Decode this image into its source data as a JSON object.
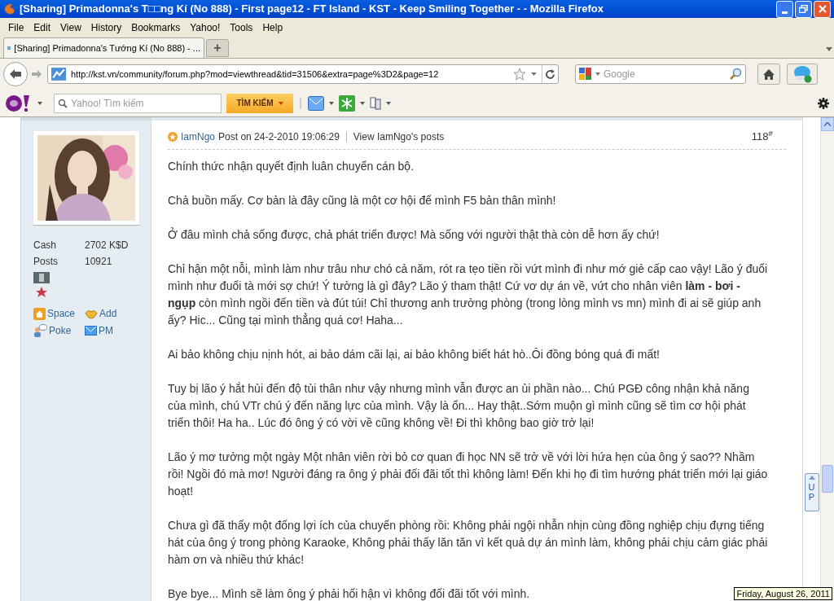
{
  "window": {
    "title": "[Sharing] Primadonna's T□□ng Kí (No 888) - First page12 - FT Island - KST - Keep Smiling Together - - Mozilla Firefox"
  },
  "menu": [
    "File",
    "Edit",
    "View",
    "History",
    "Bookmarks",
    "Yahoo!",
    "Tools",
    "Help"
  ],
  "tabs": [
    {
      "label": "[Sharing] Primadonna's Tướng Kí (No 888) - ...",
      "selected": true
    }
  ],
  "new_tab": "+",
  "address": {
    "value": "http://kst.vn/community/forum.php?mod=viewthread&tid=31506&extra=page%3D2&page=12"
  },
  "search": {
    "placeholder": "Google"
  },
  "yahoo_toolbar": {
    "search_placeholder": "Yahoo! Tìm kiếm",
    "search_button": "TÌM KIẾM"
  },
  "profile": {
    "stats": [
      {
        "label": "Cash",
        "value": "2702 K$D"
      },
      {
        "label": "Posts",
        "value": "10921"
      }
    ],
    "links": [
      {
        "kind": "space",
        "label": "Space"
      },
      {
        "kind": "add",
        "label": "Add"
      },
      {
        "kind": "poke",
        "label": "Poke"
      },
      {
        "kind": "pm",
        "label": "PM"
      }
    ]
  },
  "post": {
    "author": "IamNgo",
    "posted": "Post on 24-2-2010 19:06:29",
    "view_posts": "View IamNgo's posts",
    "floor": "118",
    "floor_mark": "#",
    "paragraphs": [
      "Chính thức nhận quyết định luân chuyển cán bộ.",
      "Chả  buồn mấy. Cơ bản là đây cũng là một cơ hội để mình F5 bản thân mình!",
      "Ở đâu mình chả sống được, chả phát triển được! Mà sống với người thật thà còn dễ hơn ấy chứ!",
      "Chỉ hận một nỗi, mình làm như trâu như chó cả năm, rót ra tẹo tiền rồi vứt mình đi như mớ giẻ cấp cao vậy! Lão ý đuổi mình như đuổi tà mới sợ chứ! Ý tưởng là gì đây? Lão ý tham thật! Cứ vơ dự án về, vứt cho nhân viên **làm - bơi - ngụp** còn mình ngồi đến tiền và đút túi! Chỉ thương anh trưởng phòng (trong lòng mình vs mn) mình đi ai sẽ giúp anh ấy? Hic... Cũng tại mình thẳng quá cơ! Haha...",
      "Ai bảo không chịu nịnh hót, ai bảo dám cãi lại, ai bảo không biết hát hò..Ôi đồng bóng quá đi mất!",
      "Tuy bị lão ý hắt hủi đến độ tủi thân như vậy nhưng mình vẫn được an ủi phần nào... Chú PGĐ công nhận khả năng của mình, chú VTr chú ý đến năng lực của mình. Vậy là ổn... Hay thật..Sớm muộn gì mình cũng sẽ tìm cơ hội phát triển thôi! Ha ha.. Lúc đó ông ý có vời về cũng không về! Đi thì không bao giờ trở lại!",
      "Lão ý mơ tưởng một ngày Một nhân viên rời bỏ cơ quan đi học NN sẽ trở về với lời hứa hẹn của ông ý sao?? Nhầm rồi! Ngồi đó mà mơ! Người đáng ra ông ý phải đối đãi tốt thì không làm! Đến khi họ đi tìm hướng phát triển mới lại giáo hoạt!",
      "Chưa gì đã thấy một đống lợi ích của chuyển phòng rồi: Không phải ngội nhẫn nhịn cùng đồng nghiệp chịu đựng tiếng hát của ông ý trong phòng Karaoke, Không phải thấy lăn tăn vì kết quả dự án mình làm, không phải chịu cảm giác phải hàm ơn và nhiều thứ khác!",
      "Bye bye... Mình sẽ làm ông ý phải hối hận vì không đối đãi tốt với mình."
    ]
  },
  "up_button": "UP",
  "clock_tooltip": "Friday, August 26, 2011"
}
